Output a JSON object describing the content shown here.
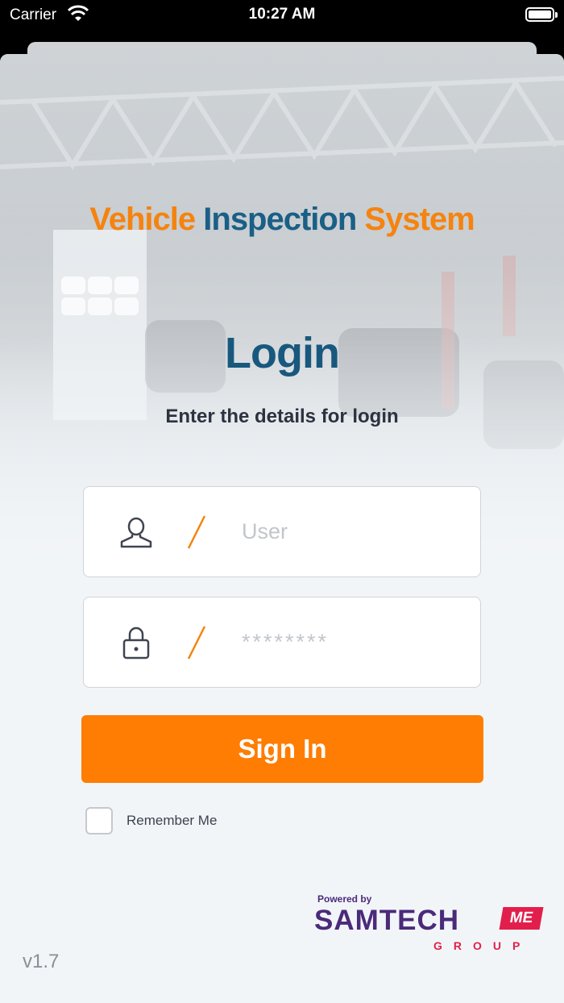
{
  "status_bar": {
    "carrier": "Carrier",
    "time": "10:27 AM"
  },
  "header": {
    "title_part1": "Vehicle",
    "title_part2": "Inspection",
    "title_part3": "System"
  },
  "login": {
    "heading": "Login",
    "subtitle": "Enter the details for login",
    "user_placeholder": "User",
    "password_placeholder": "********",
    "signin_label": "Sign In",
    "remember_label": "Remember Me"
  },
  "footer": {
    "powered_by": "Powered by",
    "brand": "SAMTECH",
    "brand_badge": "ME",
    "brand_sub": "GROUP",
    "version": "v1.7"
  },
  "colors": {
    "accent_orange": "#fe7d02",
    "brand_blue": "#1a5f86",
    "brand_purple": "#4b2a7a",
    "brand_red": "#e21f4c"
  },
  "icons": [
    "wifi-icon",
    "battery-icon",
    "user-icon",
    "lock-icon"
  ]
}
